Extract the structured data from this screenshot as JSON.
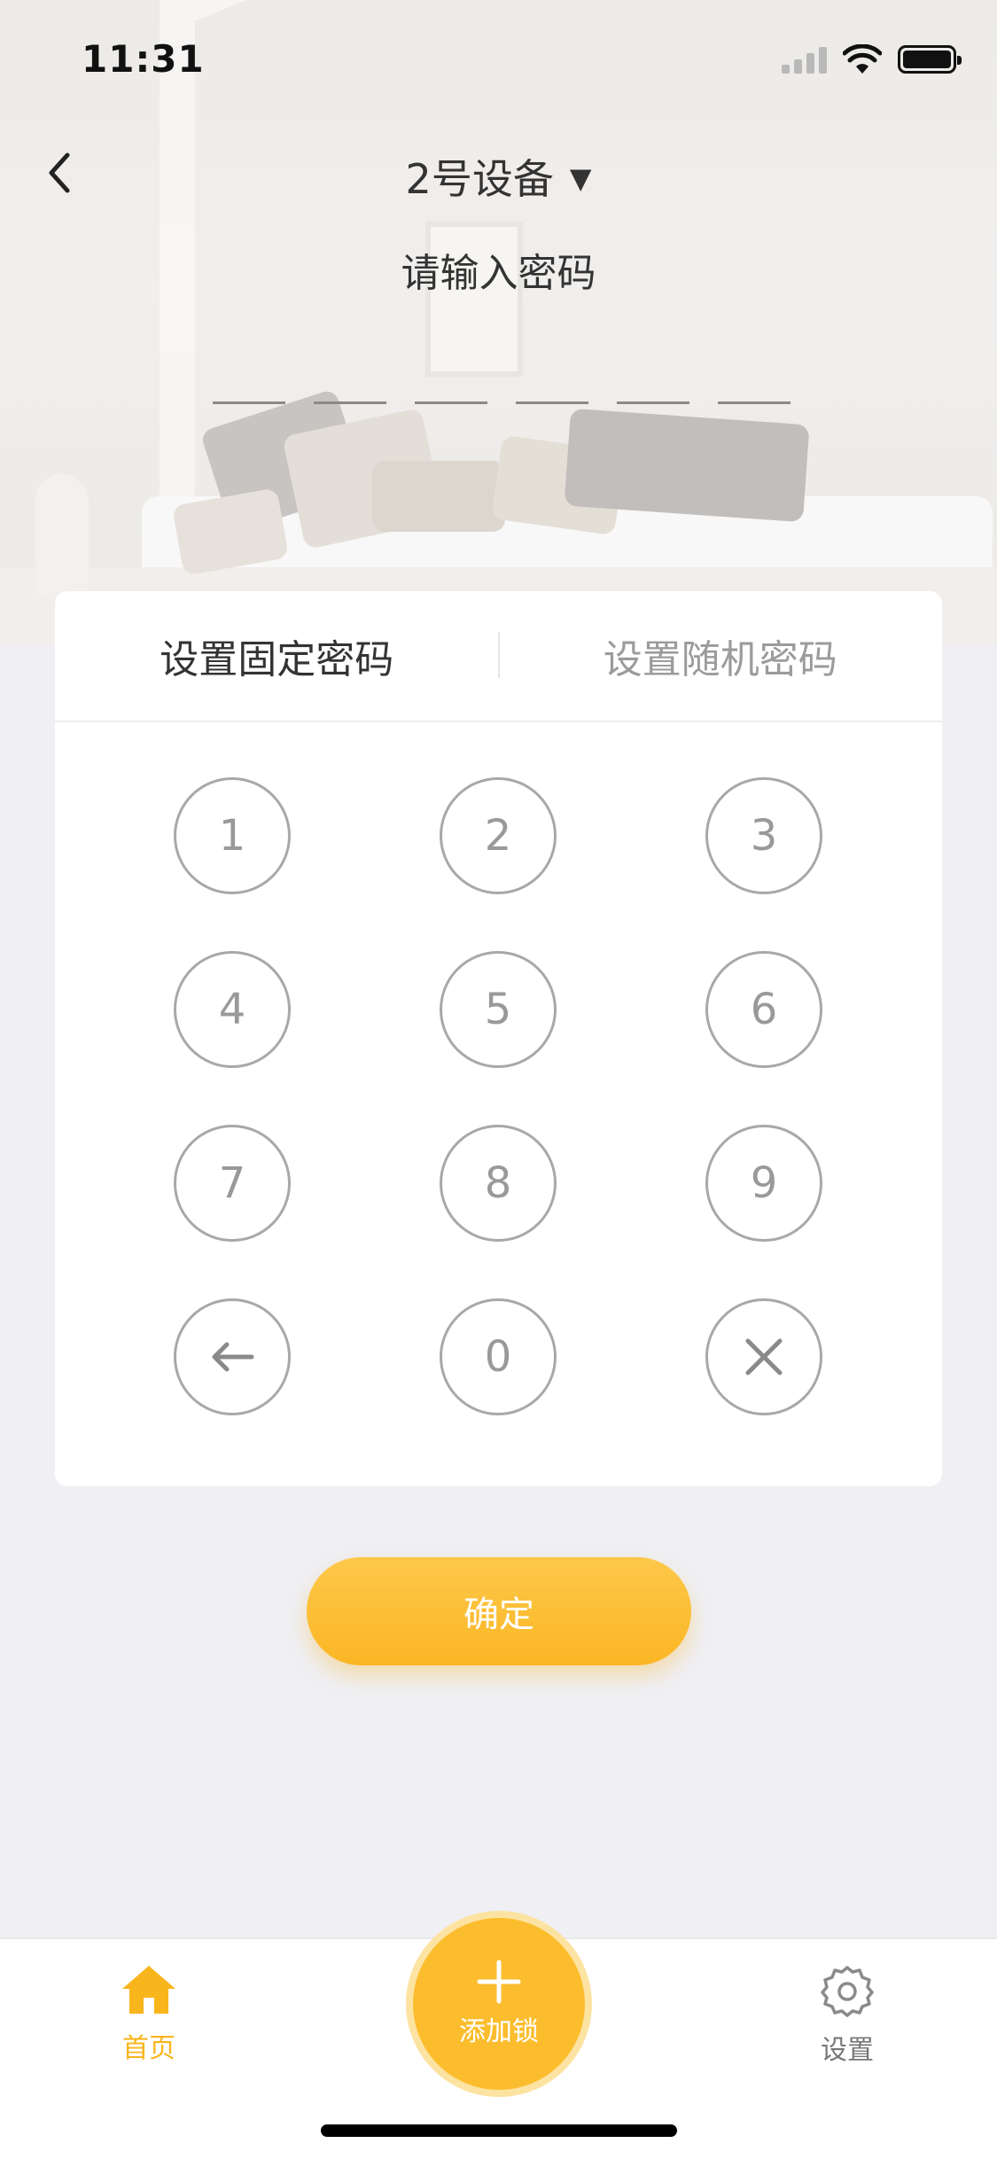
{
  "status_bar": {
    "time": "11:31"
  },
  "header": {
    "device_name": "2号设备",
    "caret": "▼",
    "prompt": "请输入密码",
    "pin_slot_count": 6
  },
  "tabs": {
    "fixed": "设置固定密码",
    "random": "设置随机密码",
    "active": "fixed"
  },
  "keypad": {
    "k1": "1",
    "k2": "2",
    "k3": "3",
    "k4": "4",
    "k5": "5",
    "k6": "6",
    "k7": "7",
    "k8": "8",
    "k9": "9",
    "k0": "0",
    "backspace_icon": "arrow-left-icon",
    "clear_icon": "close-icon"
  },
  "confirm_label": "确定",
  "tab_bar": {
    "home": "首页",
    "add_lock": "添加锁",
    "settings": "设置"
  },
  "colors": {
    "accent": "#FBB624",
    "background": "#EFEFF4",
    "key_border": "#A8A8A8"
  }
}
